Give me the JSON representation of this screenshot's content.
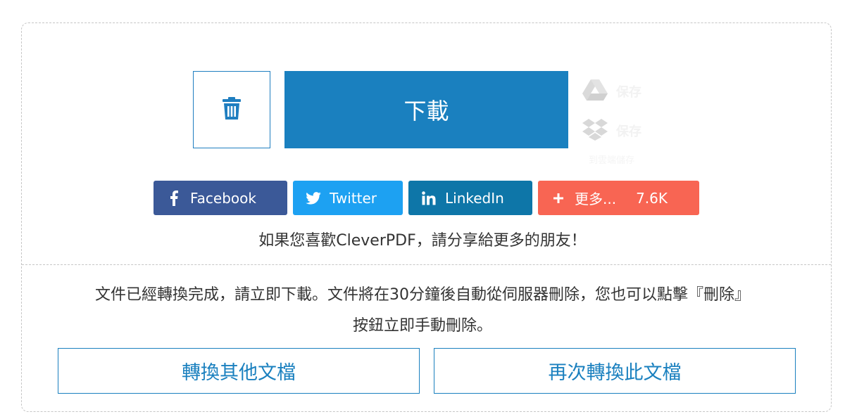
{
  "download": {
    "delete_icon": "trash-icon",
    "download_label": "下載"
  },
  "cloud": {
    "google_drive": {
      "icon": "google-drive-icon",
      "label": "保存"
    },
    "dropbox": {
      "icon": "dropbox-icon",
      "label": "保存"
    },
    "sub_label": "到雲端儲存"
  },
  "share": {
    "facebook": {
      "icon": "facebook-icon",
      "label": "Facebook",
      "color": "#3b5998"
    },
    "twitter": {
      "icon": "twitter-icon",
      "label": "Twitter",
      "color": "#1da1f2"
    },
    "linkedin": {
      "icon": "linkedin-icon",
      "label": "LinkedIn",
      "color": "#0e76a8"
    },
    "more": {
      "icon": "plus-icon",
      "label": "更多...",
      "count": "7.6K",
      "color": "#f86553"
    },
    "message": "如果您喜歡CleverPDF，請分享給更多的朋友！"
  },
  "notice": {
    "line1": "文件已經轉換完成，請立即下載。文件將在30分鐘後自動從伺服器刪除，您也可以點擊『刪除』",
    "line2": "按鈕立即手動刪除。"
  },
  "actions": {
    "convert_other": "轉換其他文檔",
    "convert_again": "再次轉換此文檔"
  },
  "colors": {
    "primary": "#1a80bf",
    "border_dashed": "#c6c6c6"
  }
}
